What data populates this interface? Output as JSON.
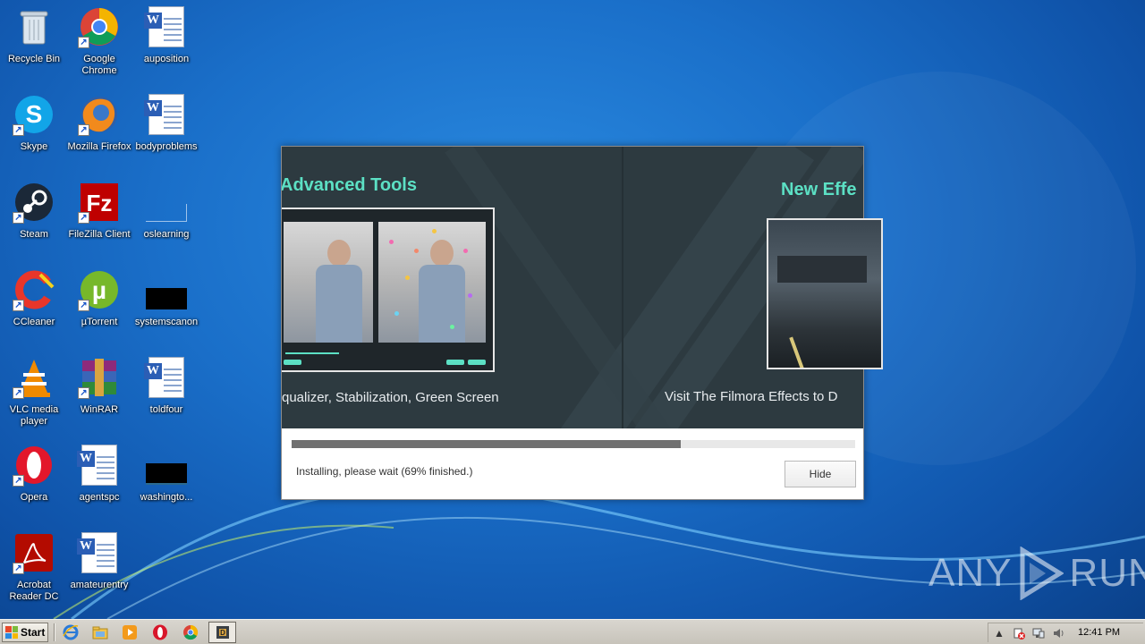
{
  "desktop": {
    "icons": [
      {
        "label": "Recycle Bin",
        "icon": "recycle-bin-icon"
      },
      {
        "label": "Google Chrome",
        "icon": "chrome-icon"
      },
      {
        "label": "auposition",
        "icon": "word-doc-icon"
      },
      {
        "label": "Skype",
        "icon": "skype-icon"
      },
      {
        "label": "Mozilla Firefox",
        "icon": "firefox-icon"
      },
      {
        "label": "bodyproblems",
        "icon": "word-doc-icon"
      },
      {
        "label": "Steam",
        "icon": "steam-icon"
      },
      {
        "label": "FileZilla Client",
        "icon": "filezilla-icon"
      },
      {
        "label": "oslearning",
        "icon": "blank-file-icon"
      },
      {
        "label": "CCleaner",
        "icon": "ccleaner-icon"
      },
      {
        "label": "µTorrent",
        "icon": "utorrent-icon"
      },
      {
        "label": "systemscanon",
        "icon": "black-file-icon"
      },
      {
        "label": "VLC media player",
        "icon": "vlc-icon"
      },
      {
        "label": "WinRAR",
        "icon": "winrar-icon"
      },
      {
        "label": "toldfour",
        "icon": "word-doc-icon"
      },
      {
        "label": "Opera",
        "icon": "opera-icon"
      },
      {
        "label": "agentspc",
        "icon": "word-doc-icon"
      },
      {
        "label": "washingto...",
        "icon": "black-file-icon"
      },
      {
        "label": "Acrobat Reader DC",
        "icon": "acrobat-icon"
      },
      {
        "label": "amateurentry",
        "icon": "word-doc-icon"
      }
    ]
  },
  "installer": {
    "slide1_title": "Advanced Tools",
    "slide1_caption": "qualizer, Stabilization, Green Screen",
    "slide2_title": "New Effe",
    "slide2_caption": "Visit The Filmora Effects to D",
    "progress_fraction": 0.69,
    "status_text": "Installing, please wait (69% finished.)",
    "hide_label": "Hide",
    "accent_color": "#5ce0c4"
  },
  "watermark": {
    "left": "ANY",
    "right": "RUN"
  },
  "taskbar": {
    "start_label": "Start",
    "clock": "12:41 PM"
  }
}
